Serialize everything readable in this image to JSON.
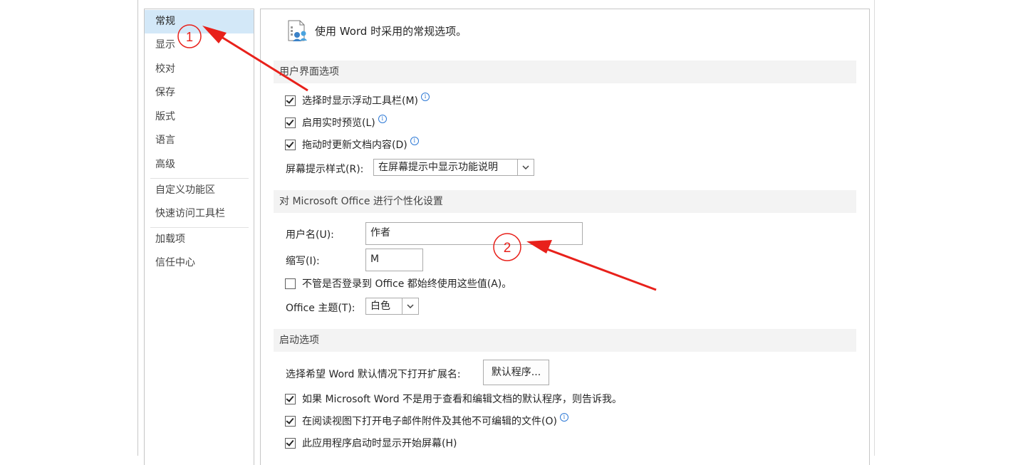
{
  "sidebar": {
    "items": [
      {
        "label": "常规"
      },
      {
        "label": "显示"
      },
      {
        "label": "校对"
      },
      {
        "label": "保存"
      },
      {
        "label": "版式"
      },
      {
        "label": "语言"
      },
      {
        "label": "高级"
      },
      {
        "label": "自定义功能区"
      },
      {
        "label": "快速访问工具栏"
      },
      {
        "label": "加载项"
      },
      {
        "label": "信任中心"
      }
    ]
  },
  "main": {
    "header": "使用 Word 时采用的常规选项。",
    "ui_section": {
      "title": "用户界面选项",
      "show_mini_toolbar": "选择时显示浮动工具栏(M)",
      "live_preview": "启用实时预览(L)",
      "update_while_drag": "拖动时更新文档内容(D)",
      "screentip_label": "屏幕提示样式(R):",
      "screentip_value": "在屏幕提示中显示功能说明"
    },
    "personalize_section": {
      "title": "对 Microsoft Office 进行个性化设置",
      "username_label": "用户名(U):",
      "username_value": "作者",
      "initials_label": "缩写(I):",
      "initials_value": "M",
      "always_use": "不管是否登录到 Office 都始终使用这些值(A)。",
      "theme_label": "Office 主题(T):",
      "theme_value": "白色"
    },
    "startup_section": {
      "title": "启动选项",
      "default_ext_label": "选择希望 Word 默认情况下打开扩展名:",
      "default_programs_button": "默认程序...",
      "tell_me_default": "如果 Microsoft Word 不是用于查看和编辑文档的默认程序，则告诉我。",
      "open_attachments_reading": "在阅读视图下打开电子邮件附件及其他不可编辑的文件(O)",
      "show_start_screen": "此应用程序启动时显示开始屏幕(H)"
    }
  },
  "annotations": {
    "marker_1": "1",
    "marker_2": "2",
    "color": "#e8211b"
  },
  "colors": {
    "selected_bg": "#d3e8f8",
    "section_bg": "#f3f3f3",
    "info_blue": "#2f7ad6"
  }
}
